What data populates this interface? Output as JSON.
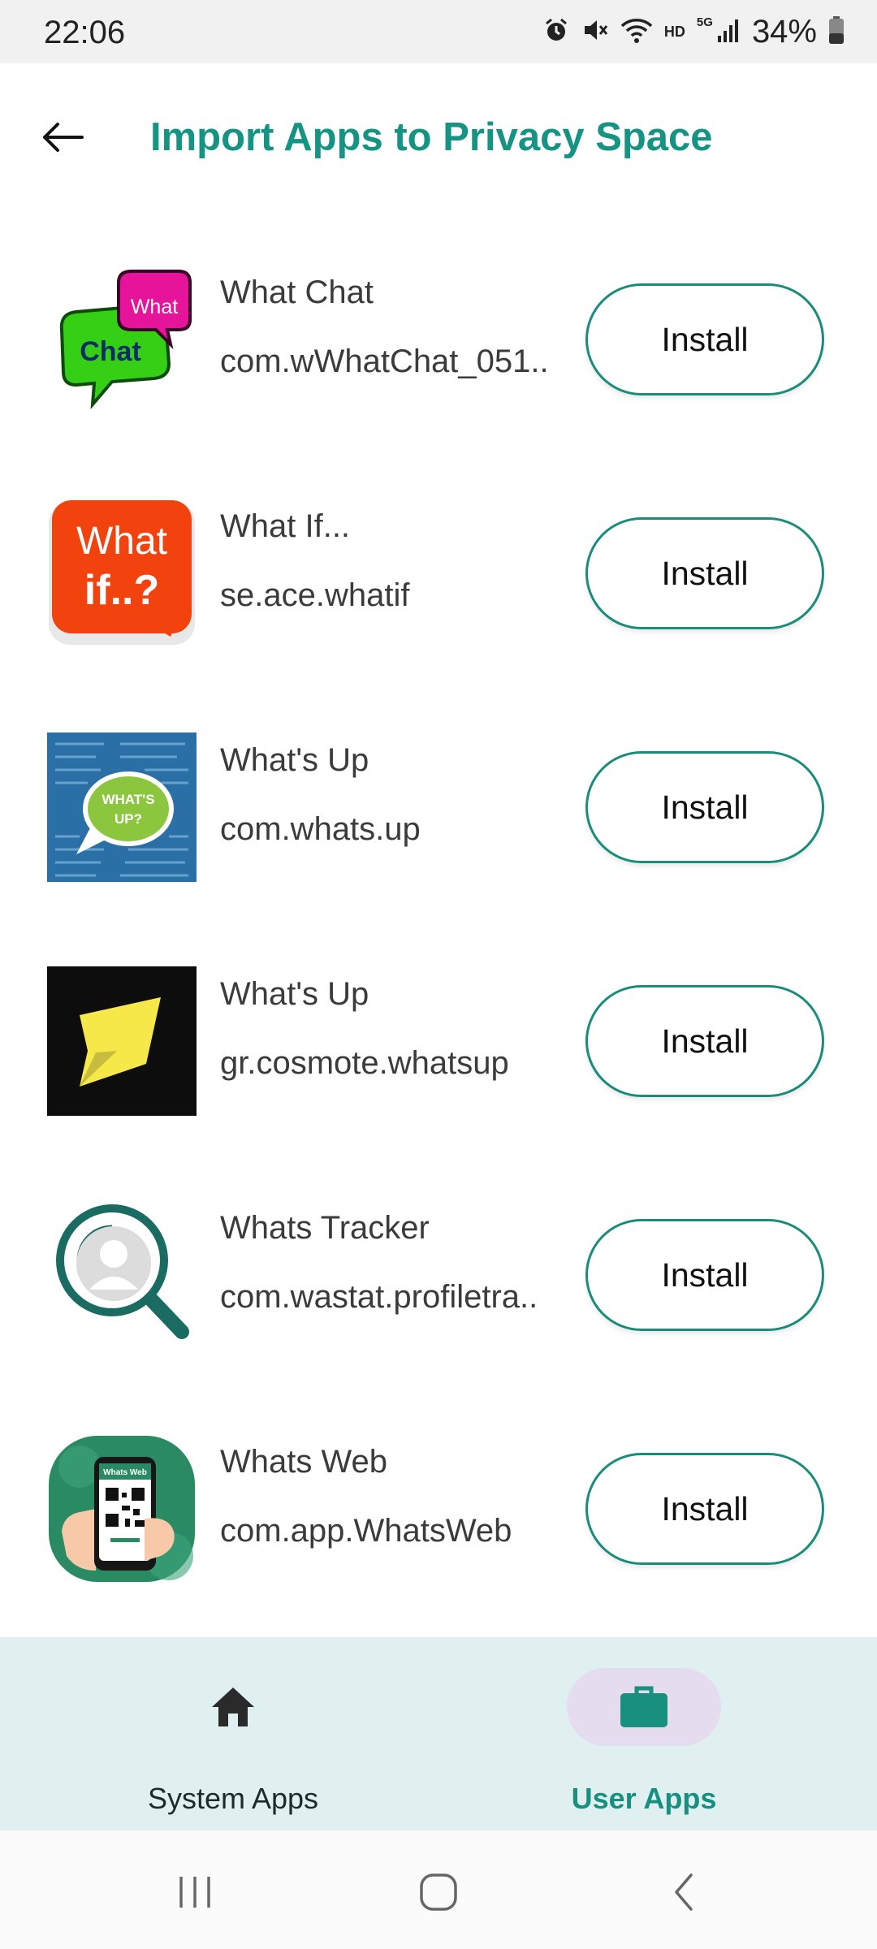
{
  "status_bar": {
    "time": "22:06",
    "battery": "34%",
    "network_hd": "HD",
    "network_5g": "5G"
  },
  "header": {
    "title": "Import Apps to Privacy Space"
  },
  "apps": [
    {
      "name": "What Chat",
      "package": "com.wWhatChat_051..",
      "button": "Install",
      "icon_text_1": "What",
      "icon_text_2": "Chat"
    },
    {
      "name": "What If...",
      "package": "se.ace.whatif",
      "button": "Install",
      "icon_text_1": "What",
      "icon_text_2": "if..?"
    },
    {
      "name": "What's Up",
      "package": "com.whats.up",
      "button": "Install",
      "icon_text_1": "WHAT'S",
      "icon_text_2": "UP?"
    },
    {
      "name": "What's Up",
      "package": "gr.cosmote.whatsup",
      "button": "Install"
    },
    {
      "name": "Whats Tracker",
      "package": "com.wastat.profiletra..",
      "button": "Install"
    },
    {
      "name": "Whats Web",
      "package": "com.app.WhatsWeb",
      "button": "Install",
      "icon_text_1": "Whats Web"
    }
  ],
  "bottom_nav": {
    "tabs": [
      {
        "label": "System Apps",
        "icon": "home-icon",
        "active": false
      },
      {
        "label": "User Apps",
        "icon": "briefcase-icon",
        "active": true
      }
    ]
  },
  "colors": {
    "accent": "#159484",
    "nav_bg": "#e0f0f0",
    "active_pill": "#e5dcf0"
  },
  "system_nav": {
    "buttons": [
      "recents-icon",
      "home-circle-icon",
      "back-chevron-icon"
    ]
  }
}
